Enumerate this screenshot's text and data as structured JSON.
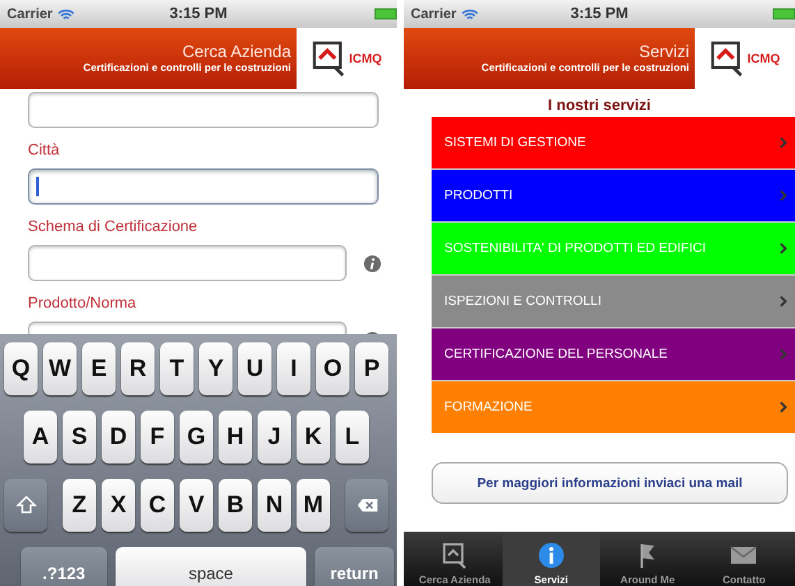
{
  "left_screen": {
    "status_bar": {
      "carrier": "Carrier",
      "time": "3:15 PM"
    },
    "header": {
      "title": "Cerca Azienda",
      "subtitle": "Certificazioni e controlli per le costruzioni",
      "logo": "ICMQ"
    },
    "fields": [
      {
        "focused": false,
        "info": false
      },
      {
        "label": "Città",
        "focused": true,
        "info": false
      },
      {
        "label": "Schema di Certificazione",
        "focused": false,
        "info": true
      },
      {
        "label": "Prodotto/Norma",
        "focused": false,
        "info": true
      }
    ],
    "keyboard": {
      "rows": [
        [
          "Q",
          "W",
          "E",
          "R",
          "T",
          "Y",
          "U",
          "I",
          "O",
          "P"
        ],
        [
          "A",
          "S",
          "D",
          "F",
          "G",
          "H",
          "J",
          "K",
          "L"
        ],
        [
          "Z",
          "X",
          "C",
          "V",
          "B",
          "N",
          "M"
        ]
      ],
      "numbers_key": ".?123",
      "space_key": "space",
      "return_key": "return"
    }
  },
  "right_screen": {
    "status_bar": {
      "carrier": "Carrier",
      "time": "3:15 PM"
    },
    "header": {
      "title": "Servizi",
      "subtitle": "Certificazioni e controlli per le costruzioni",
      "logo": "ICMQ"
    },
    "section_title": "I nostri servizi",
    "services": [
      {
        "label": "SISTEMI DI GESTIONE",
        "color": "#ff0000"
      },
      {
        "label": "PRODOTTI",
        "color": "#0000ff"
      },
      {
        "label": "SOSTENIBILITA' DI PRODOTTI ED EDIFICI",
        "color": "#00ff00"
      },
      {
        "label": "ISPEZIONI E CONTROLLI",
        "color": "#8a8a8a"
      },
      {
        "label": "CERTIFICAZIONE DEL PERSONALE",
        "color": "#800080"
      },
      {
        "label": "FORMAZIONE",
        "color": "#ff8000"
      }
    ],
    "mail_button": "Per maggiori informazioni inviaci una mail",
    "tabs": [
      {
        "label": "Cerca Azienda",
        "kind": "search",
        "selected": false
      },
      {
        "label": "Servizi",
        "kind": "info",
        "selected": true
      },
      {
        "label": "Around Me",
        "kind": "flag",
        "selected": false
      },
      {
        "label": "Contatto",
        "kind": "mail",
        "selected": false
      }
    ]
  }
}
